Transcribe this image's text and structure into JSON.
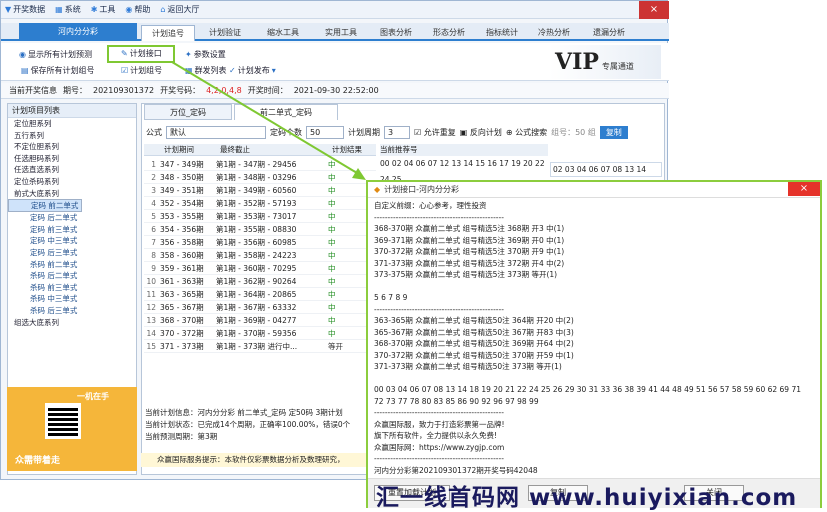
{
  "menu": {
    "items": [
      "开奖数据",
      "系统",
      "工具",
      "帮助",
      "返回大厅"
    ]
  },
  "tabs": {
    "app_tab": "河内分分彩",
    "top": [
      "计划追号",
      "计划验证",
      "缩水工具",
      "实用工具",
      "图表分析",
      "形态分析",
      "指标统计",
      "冷热分析",
      "遗漏分析"
    ]
  },
  "ribbon": {
    "show_all": "显示所有计划预测",
    "save_all": "保存所有计划组号",
    "plan_interface": "计划接口",
    "plan_group": "计划组号",
    "param_settings": "参数设置",
    "batch_list": "群发列表",
    "plan_publish": "计划发布"
  },
  "vip": {
    "logo": "VIP",
    "subtitle": "专属通道"
  },
  "info": {
    "label": "当前开奖信息",
    "issue_label": "期号：",
    "issue": "202109301372",
    "draw_label": "开奖号码：",
    "draw_numbers": "4,2,0,4,8",
    "time_label": "开奖时间：",
    "time": "2021-09-30 22:52:00"
  },
  "left_panel": {
    "title": "计划项目列表",
    "groups": [
      "定位胆系列",
      "五行系列",
      "不定位胆系列",
      "任选胆码系列",
      "任选直选系列",
      "定位杀码系列",
      "前式大底系列"
    ],
    "children": [
      "定码 前二单式",
      "定码 后二单式",
      "定码 前三单式",
      "定码 中三单式",
      "定码 后三单式",
      "杀码 前二单式",
      "杀码 后二单式",
      "杀码 前三单式",
      "杀码 中三单式",
      "杀码 后三单式"
    ],
    "last_group": "组选大底系列"
  },
  "ad": {
    "headline": "一机在手",
    "slogan": "众需带着走"
  },
  "center": {
    "tabs": [
      "万位_定码",
      "前二单式_定码"
    ],
    "formula_label": "公式",
    "formula_value": "默认",
    "periods_label": "定码个数",
    "periods_value": "50",
    "cycle_label": "计划周期",
    "cycle_value": "3",
    "allow_repeat": "允许重复",
    "reverse": "反向计划",
    "formula_search": "公式搜索",
    "group_label": "组号：50 组",
    "copy_label": "复制",
    "columns": [
      "计划期间",
      "最终截止",
      "计划结果",
      "当前推荐号"
    ],
    "rows": [
      [
        "347 - 349期",
        "第1期 - 347期 - 29456",
        "中"
      ],
      [
        "348 - 350期",
        "第1期 - 348期 - 03296",
        "中"
      ],
      [
        "349 - 351期",
        "第1期 - 349期 - 60560",
        "中"
      ],
      [
        "352 - 354期",
        "第1期 - 352期 - 57193",
        "中"
      ],
      [
        "353 - 355期",
        "第1期 - 353期 - 73017",
        "中"
      ],
      [
        "354 - 356期",
        "第1期 - 355期 - 08830",
        "中"
      ],
      [
        "356 - 358期",
        "第1期 - 356期 - 60985",
        "中"
      ],
      [
        "358 - 360期",
        "第1期 - 358期 - 24223",
        "中"
      ],
      [
        "359 - 361期",
        "第1期 - 360期 - 70295",
        "中"
      ],
      [
        "361 - 363期",
        "第1期 - 362期 - 90264",
        "中"
      ],
      [
        "363 - 365期",
        "第1期 - 364期 - 20865",
        "中"
      ],
      [
        "365 - 367期",
        "第1期 - 367期 - 63332",
        "中"
      ],
      [
        "368 - 370期",
        "第1期 - 369期 - 04277",
        "中"
      ],
      [
        "370 - 372期",
        "第1期 - 370期 - 59356",
        "中"
      ],
      [
        "371 - 373期",
        "第1期 - 373期 进行中...",
        "等开"
      ]
    ],
    "nums_text": "00 02 04 06 07 12 13 14 15 16 17 19 20 22 24 25",
    "pred_text": "02 03 04 06 07 08 13 14",
    "status_lines": [
      "当前计划信息：河内分分彩 前二单式_定码 定50码 3期计划",
      "当前计划状态：已完成14个周期，正确率100.00%，错误0个",
      "当前预测周期：第3期"
    ],
    "notice": "众赢国际服务提示：本软件仅彩票数据分析及数理研究，"
  },
  "dialog": {
    "title": "计划接口-河内分分彩",
    "close": "×",
    "lines": [
      "自定义前缀：心心参考，理性投资",
      "------------------------------------------------",
      "368-370期 众赢前二单式 组号精选5注 368期 开3 中(1)",
      "369-371期 众赢前二单式 组号精选5注 369期 开0 中(1)",
      "370-372期 众赢前二单式 组号精选5注 370期 开9 中(1)",
      "371-373期 众赢前二单式 组号精选5注 372期 开4 中(2)",
      "373-375期 众赢前二单式 组号精选5注 373期 等开(1)",
      "",
      "5 6 7 8 9",
      "------------------------------------------------",
      "363-365期 众赢前二单式 组号精选50注 364期 开20 中(2)",
      "365-367期 众赢前二单式 组号精选50注 367期 开83 中(3)",
      "368-370期 众赢前二单式 组号精选50注 369期 开64 中(2)",
      "370-372期 众赢前二单式 组号精选50注 370期 开59 中(1)",
      "371-373期 众赢前二单式 组号精选50注 373期 等开(1)",
      "",
      "00 03 04 06 07 08 13 14 18 19 20 21 22 24 25 26 29 30 31 33 36 38 39 41 44 48 49 51 56 57 58 59 60 62 69 71",
      "72 73 77 78 80 83 85 86 90 92 96 97 98 99",
      "------------------------------------------------",
      "众赢国际服，致力于打造彩票第一品牌!",
      "旗下所有软件，全力提供以永久免费!",
      "众赢国际网：https://www.zygjp.com",
      "------------------------------------------------",
      "河内分分彩第202109301372期开奖号码42048"
    ],
    "btn_reload": "重置加载计划",
    "btn_copy": "复制",
    "btn_close": "关闭"
  },
  "watermark": "汇一线首码网  www.huiyixian.com",
  "colors": {
    "accent": "#2d7ecf",
    "highlight": "#8ccd3d",
    "hit": "#1a8a1a",
    "draw": "#d22222"
  }
}
